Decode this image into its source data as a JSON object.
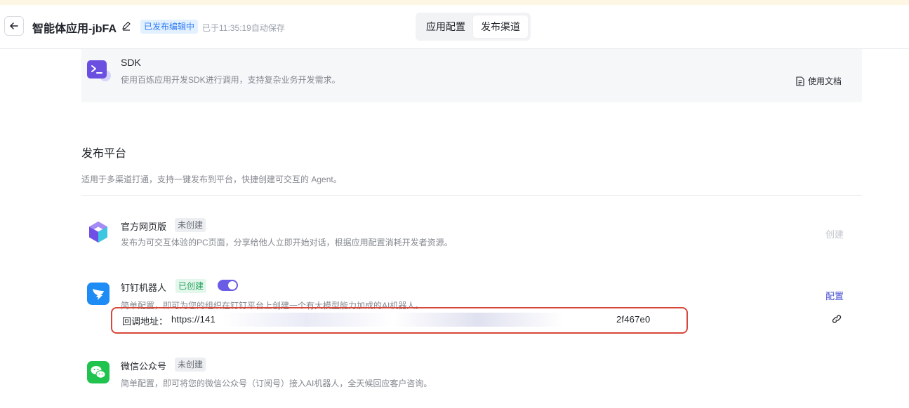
{
  "header": {
    "title": "智能体应用-jbFA",
    "status_badge": "已发布编辑中",
    "save_status": "已于11:35:19自动保存",
    "tabs": [
      {
        "label": "应用配置",
        "active": false
      },
      {
        "label": "发布渠道",
        "active": true
      }
    ]
  },
  "sdk": {
    "title": "SDK",
    "description": "使用百炼应用开发SDK进行调用，支持复杂业务开发需求。",
    "doc_link": "使用文档",
    "icon": "terminal-icon"
  },
  "platforms_section": {
    "title": "发布平台",
    "description": "适用于多渠道打通，支持一键发布到平台，快捷创建可交互的 Agent。",
    "items": [
      {
        "name": "官方网页版",
        "tag": "未创建",
        "description": "发布为可交互体验的PC页面，分享给他人立即开始对话，根据应用配置消耗开发者资源。",
        "action": "创建",
        "icon": "web-platform-icon"
      },
      {
        "name": "钉钉机器人",
        "tag": "已创建",
        "enabled": true,
        "description": "简单配置，即可为您的组织在钉钉平台上创建一个有大模型能力加成的AI机器人。",
        "action": "配置",
        "callback_label": "回调地址：",
        "callback_value": "https://141",
        "callback_tail": "2f467e0",
        "icon": "dingtalk-icon"
      },
      {
        "name": "微信公众号",
        "tag": "未创建",
        "description": "简单配置，即可将您的微信公众号（订阅号）接入AI机器人，全天候回应客户咨询。",
        "icon": "wechat-icon"
      }
    ]
  },
  "colors": {
    "accent": "#4e54d4",
    "badge_blue": "#2f7bf5",
    "tag_green": "#23a25b",
    "highlight_border": "#d8473a"
  }
}
